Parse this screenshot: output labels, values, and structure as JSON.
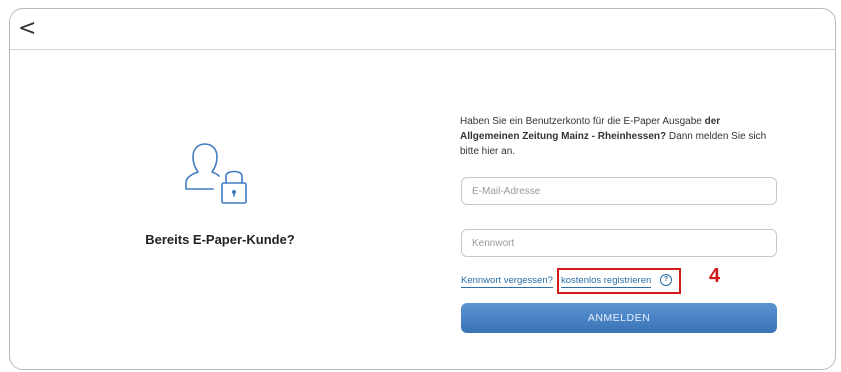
{
  "nav": {
    "back_icon": "chevron-left-icon",
    "back_glyph": "<"
  },
  "left": {
    "icon": "user-lock-icon",
    "title": "Bereits E-Paper-Kunde?"
  },
  "intro": {
    "part1": "Haben Sie ein Benutzerkonto für die E-Paper Ausgabe ",
    "bold": "der Allgemeinen Zeitung Mainz - Rheinhessen?",
    "part2": " Dann melden Sie sich bitte hier an."
  },
  "form": {
    "email_placeholder": "E-Mail-Adresse",
    "email_value": "",
    "password_placeholder": "Kennwort",
    "password_value": "",
    "forgot_link": "Kennwort vergessen?",
    "register_link": "kostenlos registrieren",
    "help_icon": "question-circle-icon",
    "help_glyph": "?",
    "submit_label": "ANMELDEN"
  },
  "annotation": {
    "marker": "4",
    "color": "#d31a1a"
  },
  "colors": {
    "accent": "#3a73b6",
    "link": "#2c6ea6"
  }
}
